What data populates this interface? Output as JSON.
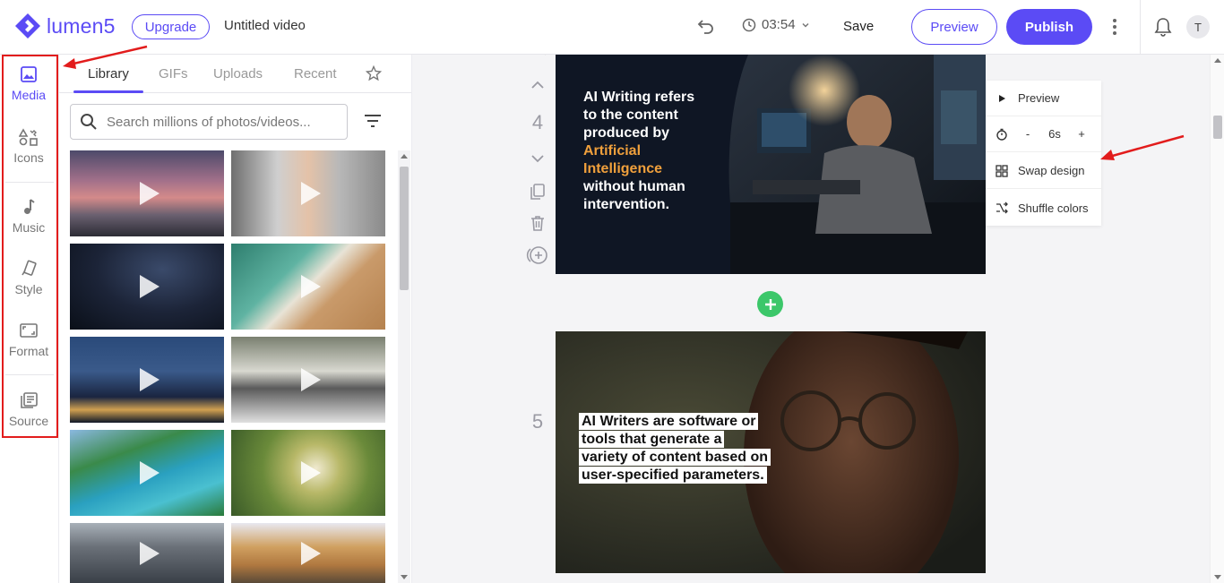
{
  "app": {
    "brand": "lumen5",
    "upgrade_label": "Upgrade",
    "video_title": "Untitled video"
  },
  "header": {
    "duration": "03:54",
    "save_label": "Save",
    "preview_label": "Preview",
    "publish_label": "Publish",
    "avatar_initial": "T"
  },
  "sidebar": {
    "items": [
      {
        "label": "Media",
        "icon": "image-icon",
        "active": true
      },
      {
        "label": "Icons",
        "icon": "shapes-icon"
      },
      {
        "label": "Music",
        "icon": "music-note-icon"
      },
      {
        "label": "Style",
        "icon": "brush-icon"
      },
      {
        "label": "Format",
        "icon": "aspect-ratio-icon"
      },
      {
        "label": "Source",
        "icon": "document-icon"
      }
    ]
  },
  "media": {
    "tabs": [
      "Library",
      "GIFs",
      "Uploads",
      "Recent"
    ],
    "active_tab": "Library",
    "search_placeholder": "Search millions of photos/videos..."
  },
  "scenes": [
    {
      "number": "4",
      "text_lines": [
        "AI Writing refers",
        "to the content",
        "produced by"
      ],
      "highlight_lines": [
        "Artificial",
        "Intelligence"
      ],
      "text_tail": [
        "without human",
        "intervention."
      ]
    },
    {
      "number": "5",
      "text_lines": [
        "AI Writers are software or",
        "tools that generate a",
        "variety of content based on",
        "user-specified parameters."
      ]
    }
  ],
  "scene_menu": {
    "preview_label": "Preview",
    "duration_minus": "-",
    "duration_value": "6s",
    "duration_plus": "+",
    "swap_label": "Swap design",
    "shuffle_label": "Shuffle colors"
  },
  "colors": {
    "accent": "#5b4bf5",
    "annotation": "#e21c1c",
    "add": "#3cc76a",
    "highlight": "#f0a03c"
  }
}
